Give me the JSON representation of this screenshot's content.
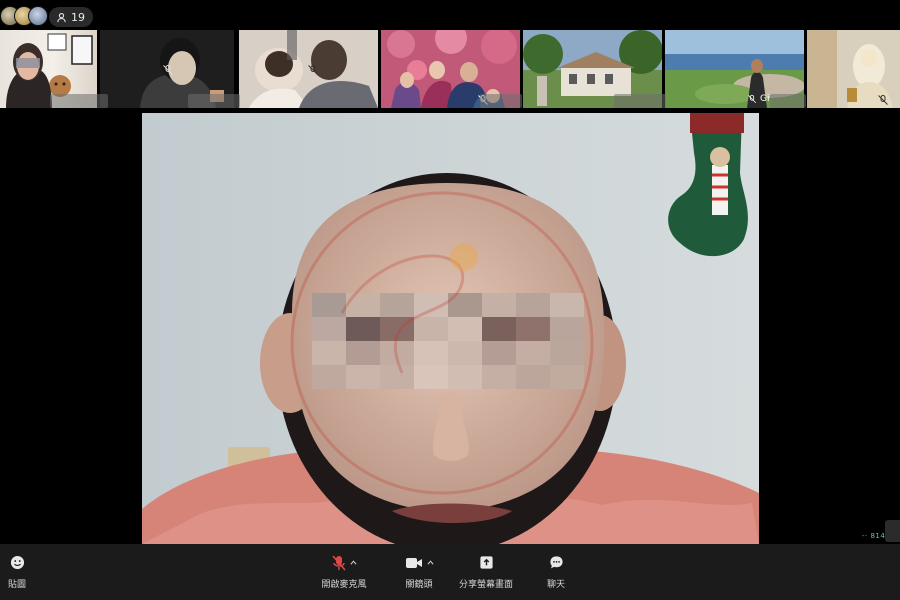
{
  "header": {
    "participant_count": "19"
  },
  "tiles": [
    {
      "id": "t1",
      "name": ""
    },
    {
      "id": "t2",
      "name": ""
    },
    {
      "id": "t3",
      "name": ""
    },
    {
      "id": "t4",
      "name": ""
    },
    {
      "id": "t5",
      "name": ""
    },
    {
      "id": "t6",
      "name": "Gi"
    },
    {
      "id": "t7",
      "name": ""
    }
  ],
  "main_video": {
    "status_text": "-· 814"
  },
  "toolbar": {
    "reactions_label": "貼圖",
    "mic_label": "開啟麥克風",
    "camera_label": "關鏡頭",
    "share_label": "分享螢幕畫面",
    "chat_label": "聊天"
  },
  "colors": {
    "background": "#000000",
    "toolbar": "#1b1b1b",
    "mute_red": "#e04848",
    "status_green": "#5fd08a"
  },
  "icons": [
    "people-icon",
    "mic-off-icon",
    "video-camera-icon",
    "screen-share-icon",
    "chat-bubble-icon",
    "smiley-icon",
    "chevron-up-icon"
  ]
}
